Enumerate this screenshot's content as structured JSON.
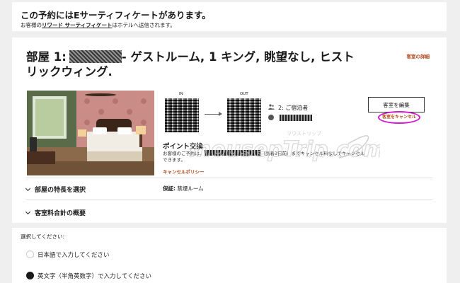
{
  "certificate_notice": {
    "title": "この予約にはEサーティフィケートがあります。",
    "sub_prefix": "お客様の",
    "sub_link": "リワード サーティフィケート",
    "sub_suffix": "はホテルへ送信されます。"
  },
  "room": {
    "title_prefix": "部屋 1:",
    "title_suffix": "- ゲストルーム, 1 キング, 眺望なし, ヒストリックウィング.",
    "details_link": "客室の詳細",
    "in_label": "IN",
    "out_label": "OUT",
    "guests": "2: ご宿泊者",
    "edit_button": "客室を編集",
    "cancel_link": "客室をキャンセル",
    "points_title": "ポイント交換",
    "points_desc_prefix": "お客様のご予約は、",
    "points_desc_suffix": "（到着3日前）までキャンセル料なしでキャンセルできます。",
    "cancel_policy": "キャンセルポリシー",
    "features_label": "部屋の特長を選択",
    "guarantee_label": "保証:",
    "guarantee_value": "禁煙ルーム",
    "summary_label": "客室料合計の概要"
  },
  "language": {
    "prompt": "選択してください:",
    "options": [
      {
        "label": "日本語で入力してください",
        "selected": false
      },
      {
        "label": "英文字（半角英数字）で入力してください",
        "selected": true
      }
    ]
  },
  "watermark": {
    "text": "mousepTrip.com",
    "sub": "マウストリップ"
  },
  "colors": {
    "accent": "#b04a1b",
    "highlight": "#d21acf"
  }
}
